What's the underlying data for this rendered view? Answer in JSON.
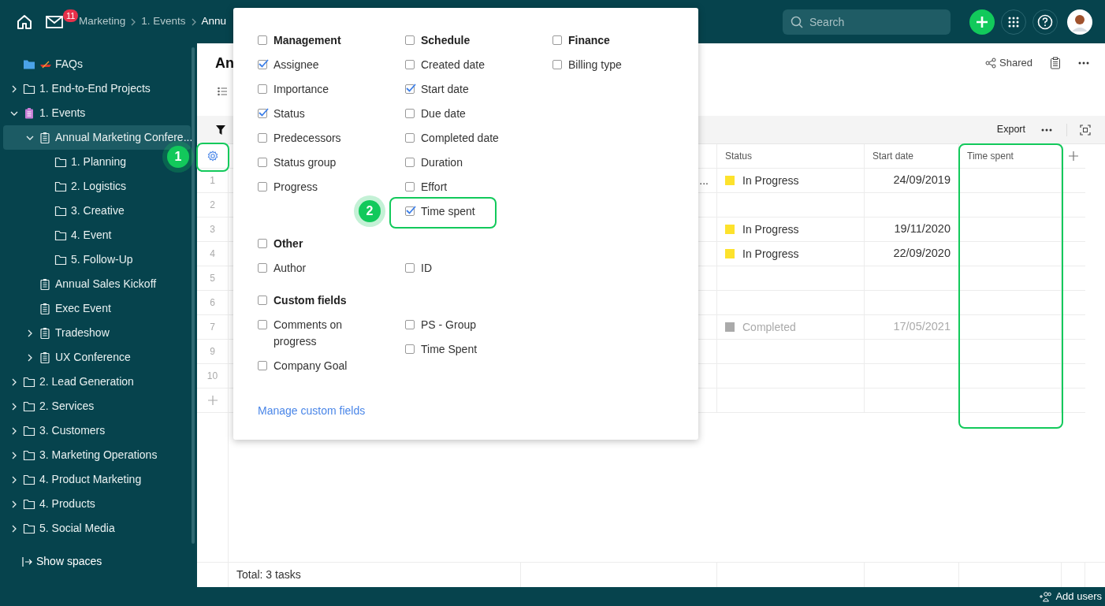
{
  "topbar": {
    "notifications": "11",
    "breadcrumbs": [
      "Marketing",
      "1. Events",
      "Annu"
    ],
    "search": {
      "placeholder": "Search"
    }
  },
  "sidebar": {
    "items": [
      {
        "label": "FAQs",
        "kind": "faq",
        "selected": false
      },
      {
        "label": "1. End-to-End Projects",
        "kind": "folder",
        "expanded": false,
        "selected": false
      },
      {
        "label": "1. Events",
        "kind": "space",
        "expanded": true,
        "selected": false,
        "children": [
          {
            "label": "Annual Marketing Confere...",
            "kind": "project",
            "expanded": true,
            "selected": true,
            "children": [
              {
                "label": "1. Planning",
                "kind": "folder",
                "selected": false
              },
              {
                "label": "2. Logistics",
                "kind": "folder",
                "selected": false
              },
              {
                "label": "3. Creative",
                "kind": "folder",
                "selected": false
              },
              {
                "label": "4. Event",
                "kind": "folder",
                "selected": false
              },
              {
                "label": "5. Follow-Up",
                "kind": "folder",
                "selected": false
              }
            ]
          },
          {
            "label": "Annual Sales Kickoff",
            "kind": "project",
            "selected": false
          },
          {
            "label": "Exec Event",
            "kind": "project",
            "selected": false
          },
          {
            "label": "Tradeshow",
            "kind": "project",
            "expanded": false,
            "selected": false
          },
          {
            "label": "UX Conference",
            "kind": "project",
            "expanded": false,
            "selected": false
          }
        ]
      },
      {
        "label": "2. Lead Generation",
        "kind": "folder",
        "expanded": false,
        "selected": false
      },
      {
        "label": "2. Services",
        "kind": "folder",
        "expanded": false,
        "selected": false
      },
      {
        "label": "3. Customers",
        "kind": "folder",
        "expanded": false,
        "selected": false
      },
      {
        "label": "3. Marketing Operations",
        "kind": "folder",
        "expanded": false,
        "selected": false
      },
      {
        "label": "4. Product Marketing",
        "kind": "folder",
        "expanded": false,
        "selected": false
      },
      {
        "label": "4. Products",
        "kind": "folder",
        "expanded": false,
        "selected": false
      },
      {
        "label": "5. Social Media",
        "kind": "folder",
        "expanded": false,
        "selected": false
      }
    ],
    "footer": "Show spaces"
  },
  "page": {
    "title": "An",
    "shared": "Shared"
  },
  "toolbar": {
    "export": "Export"
  },
  "table": {
    "columns": [
      "Status",
      "Start date",
      "Time spent"
    ],
    "rows": [
      {
        "number": "1",
        "column_3": "...",
        "status": {
          "label": "In Progress",
          "color": "#fde22c"
        },
        "start_date": "24/09/2019",
        "dimmed": false
      },
      {
        "number": "2"
      },
      {
        "number": "3",
        "status": {
          "label": "In Progress",
          "color": "#fde22c"
        },
        "start_date": "19/11/2020",
        "dimmed": false
      },
      {
        "number": "4",
        "status": {
          "label": "In Progress",
          "color": "#fde22c"
        },
        "start_date": "22/09/2020",
        "dimmed": false
      },
      {
        "number": "5"
      },
      {
        "number": "6"
      },
      {
        "number": "7",
        "status": {
          "label": "Completed",
          "color": "#aaaaaa"
        },
        "start_date": "17/05/2021",
        "dimmed": true
      },
      {
        "number": "9"
      },
      {
        "number": "10"
      }
    ],
    "total": "Total: 3 tasks"
  },
  "popover": {
    "sections": [
      {
        "columns": [
          {
            "header": {
              "label": "Management",
              "checked": false
            },
            "items": [
              {
                "label": "Assignee",
                "checked": true
              },
              {
                "label": "Importance",
                "checked": false
              },
              {
                "label": "Status",
                "checked": true
              },
              {
                "label": "Predecessors",
                "checked": false
              },
              {
                "label": "Status group",
                "checked": false
              },
              {
                "label": "Progress",
                "checked": false
              }
            ]
          },
          {
            "header": {
              "label": "Schedule",
              "checked": false
            },
            "items": [
              {
                "label": "Created date",
                "checked": false
              },
              {
                "label": "Start date",
                "checked": true
              },
              {
                "label": "Due date",
                "checked": false
              },
              {
                "label": "Completed date",
                "checked": false
              },
              {
                "label": "Duration",
                "checked": false
              },
              {
                "label": "Effort",
                "checked": false
              },
              {
                "label": "Time spent",
                "checked": true
              }
            ]
          },
          {
            "header": {
              "label": "Finance",
              "checked": false
            },
            "items": [
              {
                "label": "Billing type",
                "checked": false
              }
            ]
          }
        ]
      },
      {
        "header": {
          "label": "Other",
          "checked": false
        },
        "columns": [
          {
            "items": [
              {
                "label": "Author",
                "checked": false
              }
            ]
          },
          {
            "items": [
              {
                "label": "ID",
                "checked": false
              }
            ]
          }
        ]
      },
      {
        "header": {
          "label": "Custom fields",
          "checked": false
        },
        "columns": [
          {
            "items": [
              {
                "label": "Comments on progress",
                "checked": false
              },
              {
                "label": "Company Goal",
                "checked": false
              }
            ]
          },
          {
            "items": [
              {
                "label": "PS - Group",
                "checked": false
              },
              {
                "label": "Time Spent",
                "checked": false
              }
            ]
          }
        ]
      }
    ],
    "link": "Manage custom fields"
  },
  "callouts": [
    {
      "label": "1"
    },
    {
      "label": "2"
    }
  ],
  "bottom_bar": {
    "add_users": "Add users"
  }
}
